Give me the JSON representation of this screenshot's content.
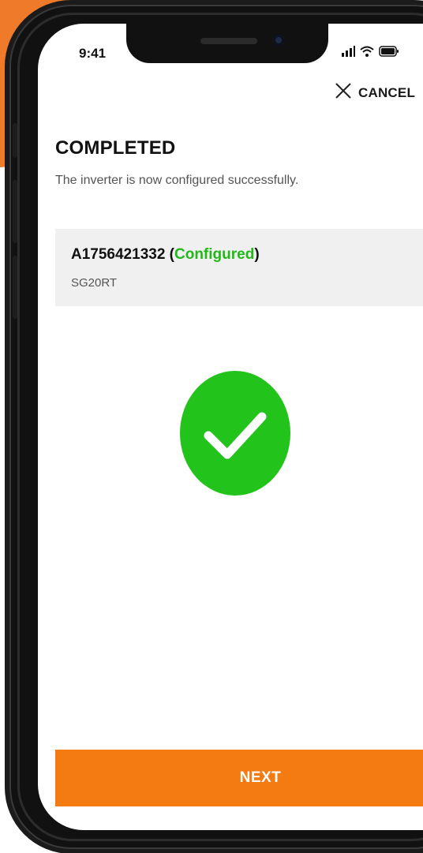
{
  "status_bar": {
    "time": "9:41"
  },
  "header": {
    "cancel_label": "CANCEL"
  },
  "main": {
    "title": "COMPLETED",
    "subtitle": "The inverter is now configured successfully.",
    "device": {
      "serial": "A1756421332",
      "status_open": " (",
      "status": "Configured",
      "status_close": ")",
      "model": "SG20RT"
    }
  },
  "footer": {
    "next_label": "NEXT"
  },
  "colors": {
    "accent": "#f47a12",
    "success": "#22c31a",
    "background_orange": "#ee7a2a",
    "card": "#f0f0f0"
  },
  "icons": [
    "close-icon",
    "check-icon",
    "signal-icon",
    "wifi-icon",
    "battery-icon"
  ]
}
